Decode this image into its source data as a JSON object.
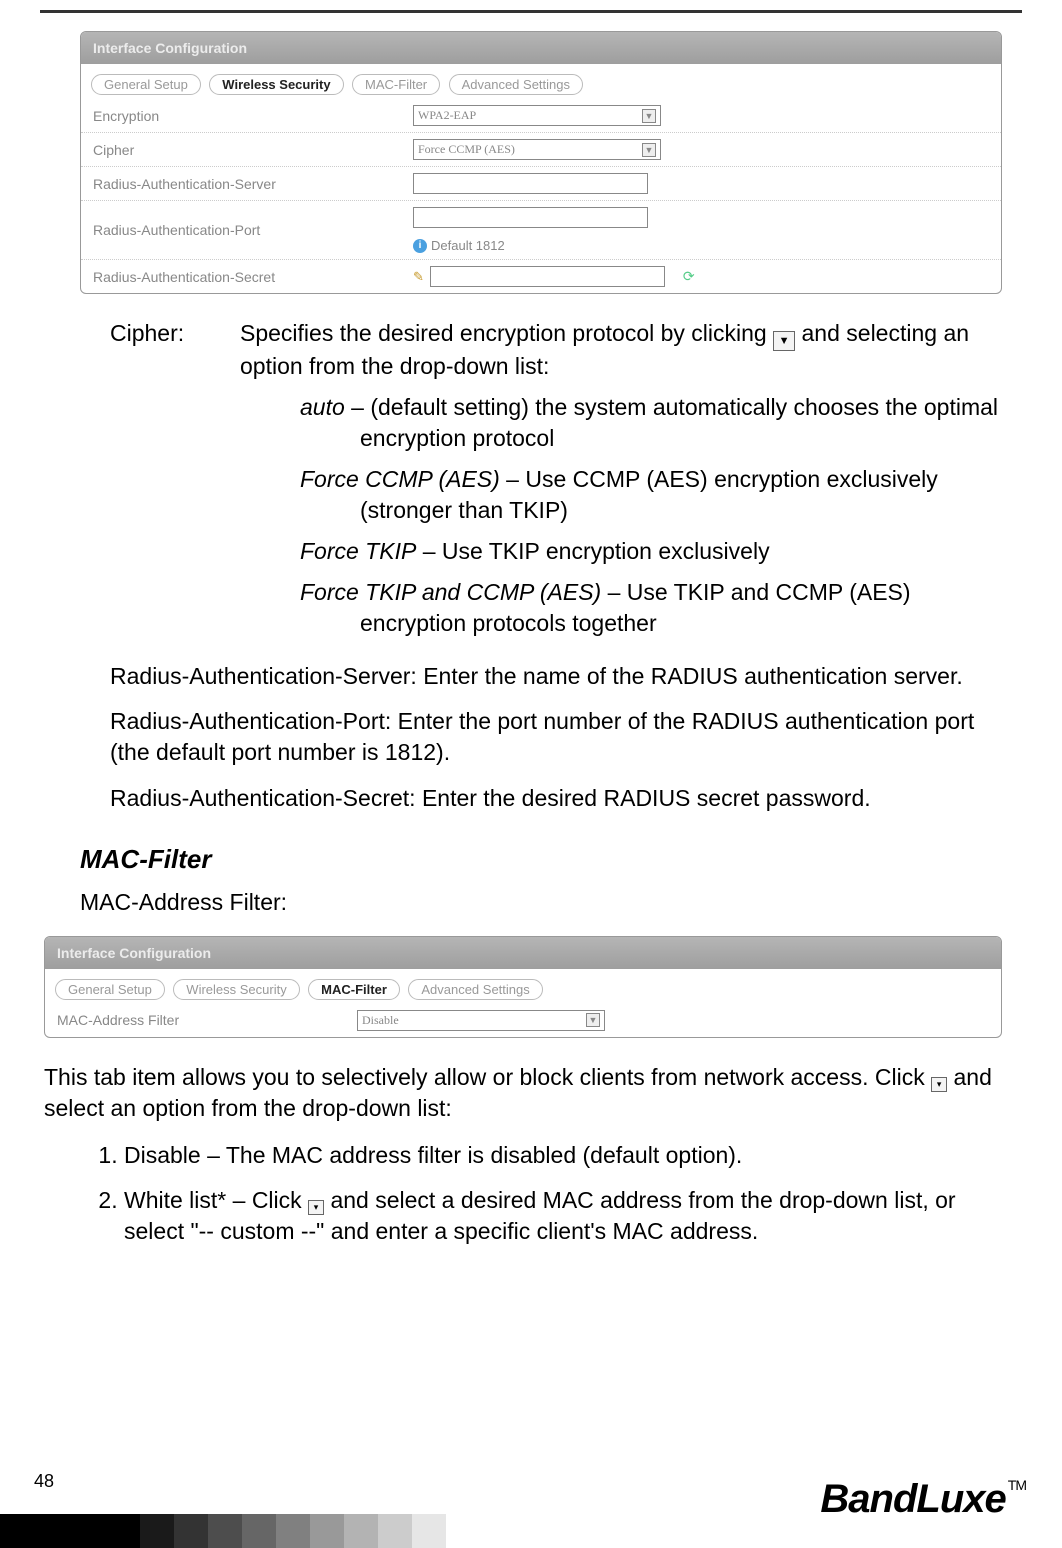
{
  "panel1": {
    "title": "Interface Configuration",
    "tabs": [
      "General Setup",
      "Wireless Security",
      "MAC-Filter",
      "Advanced Settings"
    ],
    "active_tab": "Wireless Security",
    "rows": {
      "encryption": {
        "label": "Encryption",
        "value": "WPA2-EAP"
      },
      "cipher": {
        "label": "Cipher",
        "value": "Force CCMP (AES)"
      },
      "server": {
        "label": "Radius-Authentication-Server",
        "value": ""
      },
      "port": {
        "label": "Radius-Authentication-Port",
        "value": "",
        "hint": "Default 1812"
      },
      "secret": {
        "label": "Radius-Authentication-Secret",
        "value": ""
      }
    }
  },
  "body": {
    "cipher_term": "Cipher:",
    "cipher_body": "Specifies the desired encryption protocol by clicking",
    "cipher_body2": "and selecting an option from the drop-down list:",
    "opt_auto_i": "auto",
    "opt_auto_t": " – (default setting) the system automatically chooses the optimal encryption protocol",
    "opt_ccmp_i": "Force CCMP (AES)",
    "opt_ccmp_t": " – Use CCMP (AES) encryption exclusively (stronger than TKIP)",
    "opt_tkip_i": "Force TKIP",
    "opt_tkip_t": " – Use TKIP encryption exclusively",
    "opt_both_i": "Force TKIP and CCMP (AES)",
    "opt_both_t": " – Use TKIP and CCMP (AES) encryption protocols together",
    "ras_server": "Radius-Authentication-Server:    Enter the name of the RADIUS authentication server.",
    "ras_port": "Radius-Authentication-Port:    Enter the port number of the RADIUS authentication port (the default port number is 1812).",
    "ras_secret": "Radius-Authentication-Secret:    Enter the desired RADIUS secret password.",
    "mac_h": "MAC-Filter",
    "mac_sub": "MAC-Address Filter:"
  },
  "panel2": {
    "title": "Interface Configuration",
    "tabs": [
      "General Setup",
      "Wireless Security",
      "MAC-Filter",
      "Advanced Settings"
    ],
    "active_tab": "MAC-Filter",
    "row": {
      "label": "MAC-Address Filter",
      "value": "Disable"
    }
  },
  "after": {
    "p1a": "This tab item allows you to selectively allow or block clients from network access. Click ",
    "p1b": " and select an option from the drop-down list:",
    "li1": "Disable – The MAC address filter is disabled (default option).",
    "li2a": "White list* – Click ",
    "li2b": " and select a desired MAC address from the drop-down list, or select \"-- custom --\" and enter a specific client's MAC address."
  },
  "footer": {
    "page": "48",
    "logo": "BandLuxe",
    "tm": "TM"
  }
}
